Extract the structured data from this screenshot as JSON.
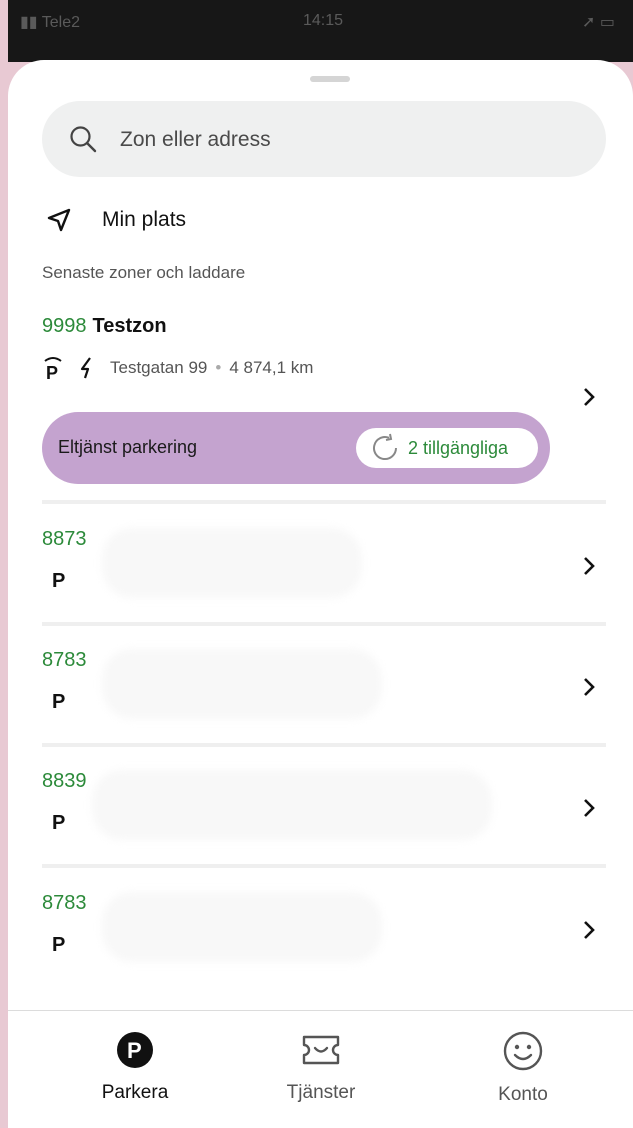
{
  "status": {
    "carrier": "Tele2",
    "time": "14:15"
  },
  "search": {
    "placeholder": "Zon eller adress"
  },
  "my_location": {
    "label": "Min plats"
  },
  "recent": {
    "title": "Senaste zoner och laddare",
    "featured": {
      "number": "9998",
      "name": "Testzon",
      "address": "Testgatan 99",
      "distance": "4 874,1 km",
      "service_label": "Eltjänst parkering",
      "availability": "2 tillgängliga"
    },
    "items": [
      {
        "number": "8873",
        "p": "P"
      },
      {
        "number": "8783",
        "p": "P"
      },
      {
        "number": "8839",
        "p": "P"
      },
      {
        "number": "8783",
        "p": "P"
      }
    ]
  },
  "tabs": [
    {
      "label": "Parkera",
      "active": true
    },
    {
      "label": "Tjänster",
      "active": false
    },
    {
      "label": "Konto",
      "active": false
    }
  ],
  "colors": {
    "accent_green": "#2c8a3a",
    "pill_purple": "#c4a3cf",
    "background_pink": "#e8c9d3"
  }
}
